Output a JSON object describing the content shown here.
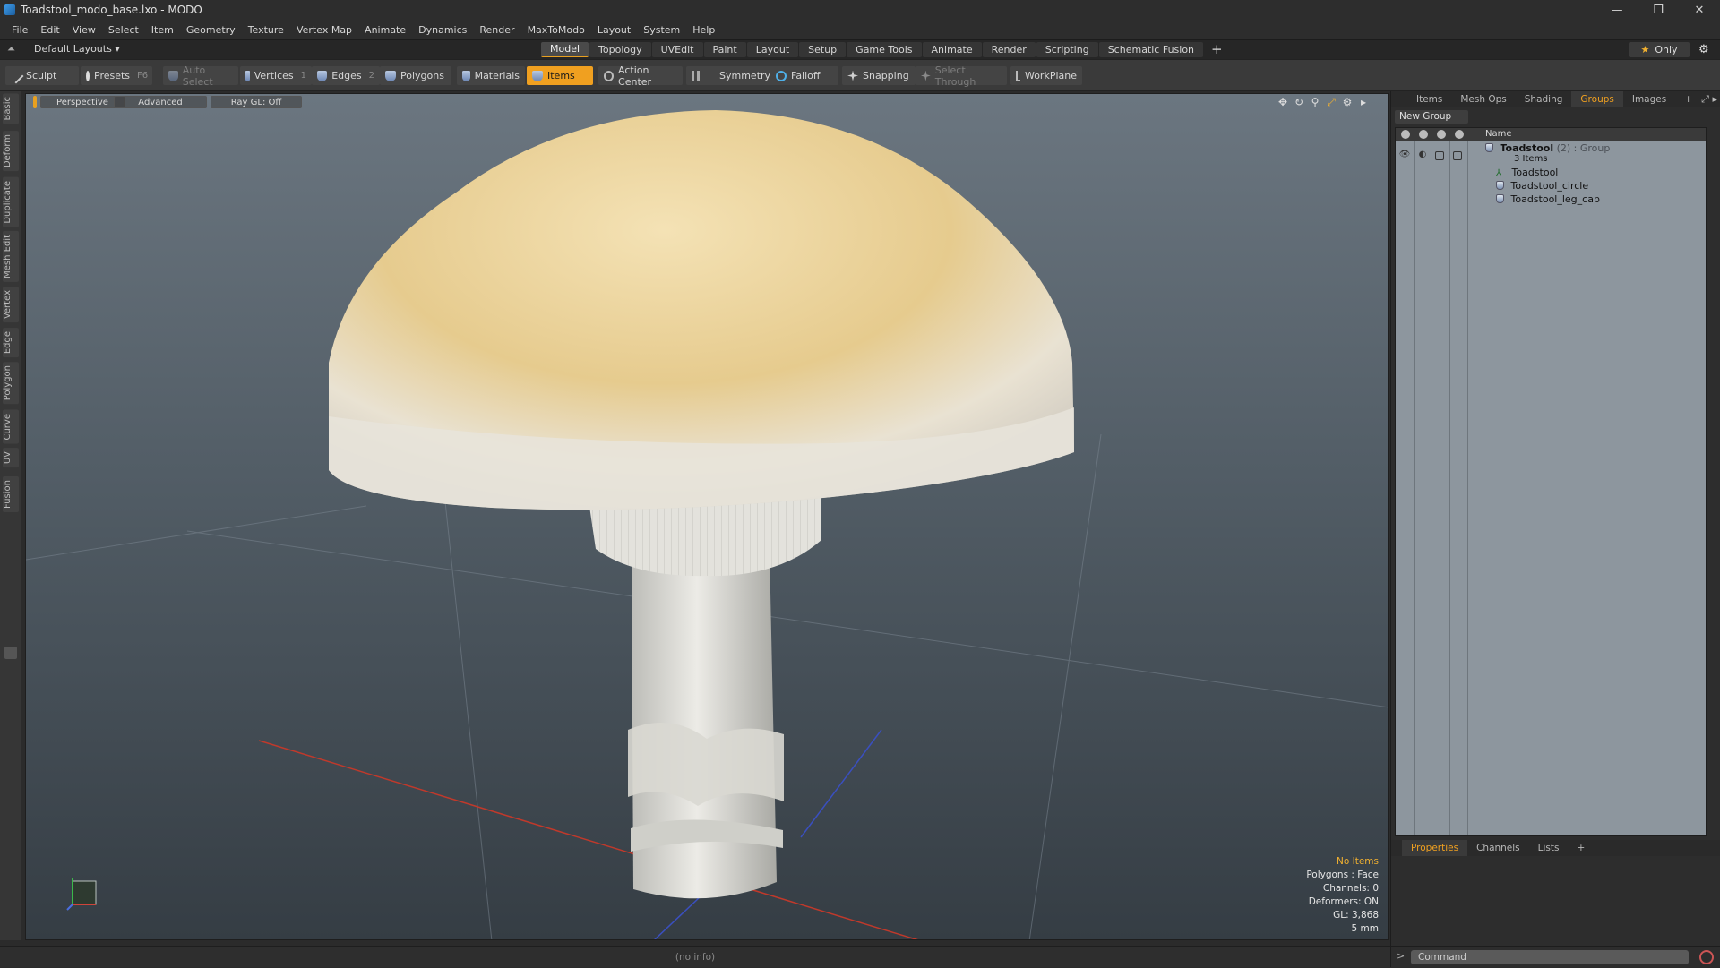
{
  "window": {
    "title": "Toadstool_modo_base.lxo - MODO"
  },
  "menu": [
    "File",
    "Edit",
    "View",
    "Select",
    "Item",
    "Geometry",
    "Texture",
    "Vertex Map",
    "Animate",
    "Dynamics",
    "Render",
    "MaxToModo",
    "Layout",
    "System",
    "Help"
  ],
  "layout": {
    "default_label": "Default Layouts ▾",
    "tabs": [
      "Model",
      "Topology",
      "UVEdit",
      "Paint",
      "Layout",
      "Setup",
      "Game Tools",
      "Animate",
      "Render",
      "Scripting",
      "Schematic Fusion"
    ],
    "active_tab": "Model",
    "only_label": "Only"
  },
  "toolbar": {
    "sculpt": "Sculpt",
    "presets": "Presets",
    "presets_key": "F6",
    "auto_select": "Auto Select",
    "vertices": "Vertices",
    "vertices_key": "1",
    "edges": "Edges",
    "edges_key": "2",
    "polygons": "Polygons",
    "materials": "Materials",
    "items": "Items",
    "action_center": "Action Center",
    "symmetry": "Symmetry",
    "falloff": "Falloff",
    "snapping": "Snapping",
    "select_through": "Select Through",
    "workplane": "WorkPlane"
  },
  "left_tabs": [
    "Basic",
    "Deform",
    "Duplicate",
    "Mesh Edit",
    "Vertex",
    "Edge",
    "Polygon",
    "Curve",
    "UV",
    "Fusion"
  ],
  "viewport": {
    "view": "Perspective",
    "shading": "Advanced",
    "raygl": "Ray GL: Off",
    "hud": {
      "status": "No Items",
      "polygons": "Polygons : Face",
      "channels": "Channels: 0",
      "deformers": "Deformers: ON",
      "gl": "GL: 3,868",
      "scale": "5 mm"
    }
  },
  "statusbar": {
    "info": "(no info)"
  },
  "right_panel": {
    "tabs": [
      "Items",
      "Mesh Ops",
      "Shading",
      "Groups",
      "Images"
    ],
    "active_tab": "Groups",
    "new_group": "New Group",
    "column_name": "Name",
    "group": {
      "name": "Toadstool",
      "meta": "(2) : Group",
      "count": "3 Items"
    },
    "children": [
      "Toadstool",
      "Toadstool_circle",
      "Toadstool_leg_cap"
    ]
  },
  "properties": {
    "tabs": [
      "Properties",
      "Channels",
      "Lists"
    ],
    "active_tab": "Properties"
  },
  "command": {
    "placeholder": "Command"
  },
  "colors": {
    "accent": "#f0a020",
    "viewport_top": "#6b7680",
    "viewport_bottom": "#353d44"
  }
}
